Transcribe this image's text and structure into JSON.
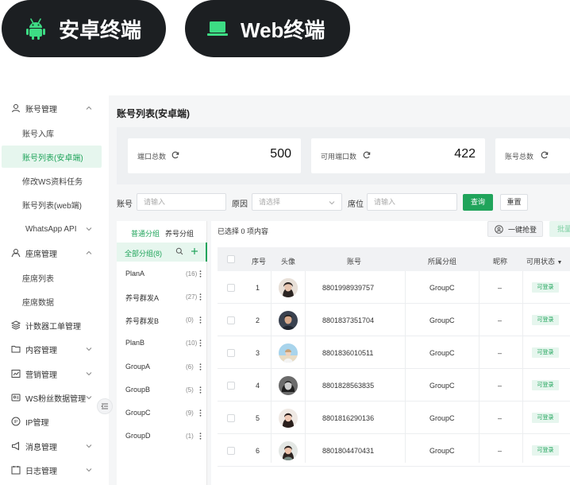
{
  "pills": {
    "android": {
      "label": "安卓终端",
      "icon": "android-icon"
    },
    "web": {
      "label": "Web终端",
      "icon": "laptop-icon"
    }
  },
  "sidebar": {
    "groups": [
      {
        "label": "账号管理",
        "icon": "user-icon",
        "expanded": true
      },
      {
        "label": "座席管理",
        "icon": "seat-icon",
        "expanded": true
      },
      {
        "label": "计数器工单管理",
        "icon": "layers-icon"
      },
      {
        "label": "内容管理",
        "icon": "folder-icon"
      },
      {
        "label": "营销管理",
        "icon": "chart-icon"
      },
      {
        "label": "WS粉丝数据管理",
        "icon": "fans-icon"
      },
      {
        "label": "IP管理",
        "icon": "ip-icon"
      },
      {
        "label": "消息管理",
        "icon": "megaphone-icon"
      },
      {
        "label": "日志管理",
        "icon": "log-icon"
      }
    ],
    "account_items": [
      "账号入库",
      "账号列表(安卓端)",
      "修改WS资料任务",
      "账号列表(web端)",
      "WhatsApp API"
    ],
    "seat_items": [
      "座席列表",
      "座席数据"
    ]
  },
  "page": {
    "title": "账号列表(安卓端)"
  },
  "stats": [
    {
      "label": "端口总数",
      "value": "500"
    },
    {
      "label": "可用端口数",
      "value": "422"
    },
    {
      "label": "账号总数",
      "value": ""
    }
  ],
  "filters": {
    "account_label": "账号",
    "account_placeholder": "请输入",
    "reason_label": "原因",
    "reason_placeholder": "请选择",
    "seat_label": "席位",
    "seat_placeholder": "请输入",
    "query": "查询",
    "reset": "重置"
  },
  "groups": {
    "tabs": [
      "普通分组",
      "养号分组"
    ],
    "all_label": "全部分组(8)",
    "items": [
      {
        "name": "PlanA",
        "count": "(16)"
      },
      {
        "name": "养号群发A",
        "count": "(27)"
      },
      {
        "name": "养号群发B",
        "count": "(0)"
      },
      {
        "name": "PlanB",
        "count": "(10)"
      },
      {
        "name": "GroupA",
        "count": "(6)"
      },
      {
        "name": "GroupB",
        "count": "(5)"
      },
      {
        "name": "GroupC",
        "count": "(9)"
      },
      {
        "name": "GroupD",
        "count": "(1)"
      }
    ]
  },
  "table": {
    "selected": "已选择 0 项内容",
    "grab_button": "一键抢登",
    "batch_button": "批量",
    "headers": {
      "index": "序号",
      "avatar": "头像",
      "account": "账号",
      "group": "所属分组",
      "nickname": "昵称",
      "status": "可用状态"
    },
    "rows": [
      {
        "index": "1",
        "account": "8801998939757",
        "group": "GroupC",
        "nickname": "–",
        "status": "可登录"
      },
      {
        "index": "2",
        "account": "8801837351704",
        "group": "GroupC",
        "nickname": "–",
        "status": "可登录"
      },
      {
        "index": "3",
        "account": "8801836010511",
        "group": "GroupC",
        "nickname": "–",
        "status": "可登录"
      },
      {
        "index": "4",
        "account": "8801828563835",
        "group": "GroupC",
        "nickname": "–",
        "status": "可登录"
      },
      {
        "index": "5",
        "account": "8801816290136",
        "group": "GroupC",
        "nickname": "–",
        "status": "可登录"
      },
      {
        "index": "6",
        "account": "8801804470431",
        "group": "GroupC",
        "nickname": "–",
        "status": "可登录"
      }
    ]
  },
  "colors": {
    "accent": "#20a45b",
    "accent_light": "#e6f6ee",
    "pill_bg": "#1c1f22",
    "android_green": "#3ddc84"
  }
}
